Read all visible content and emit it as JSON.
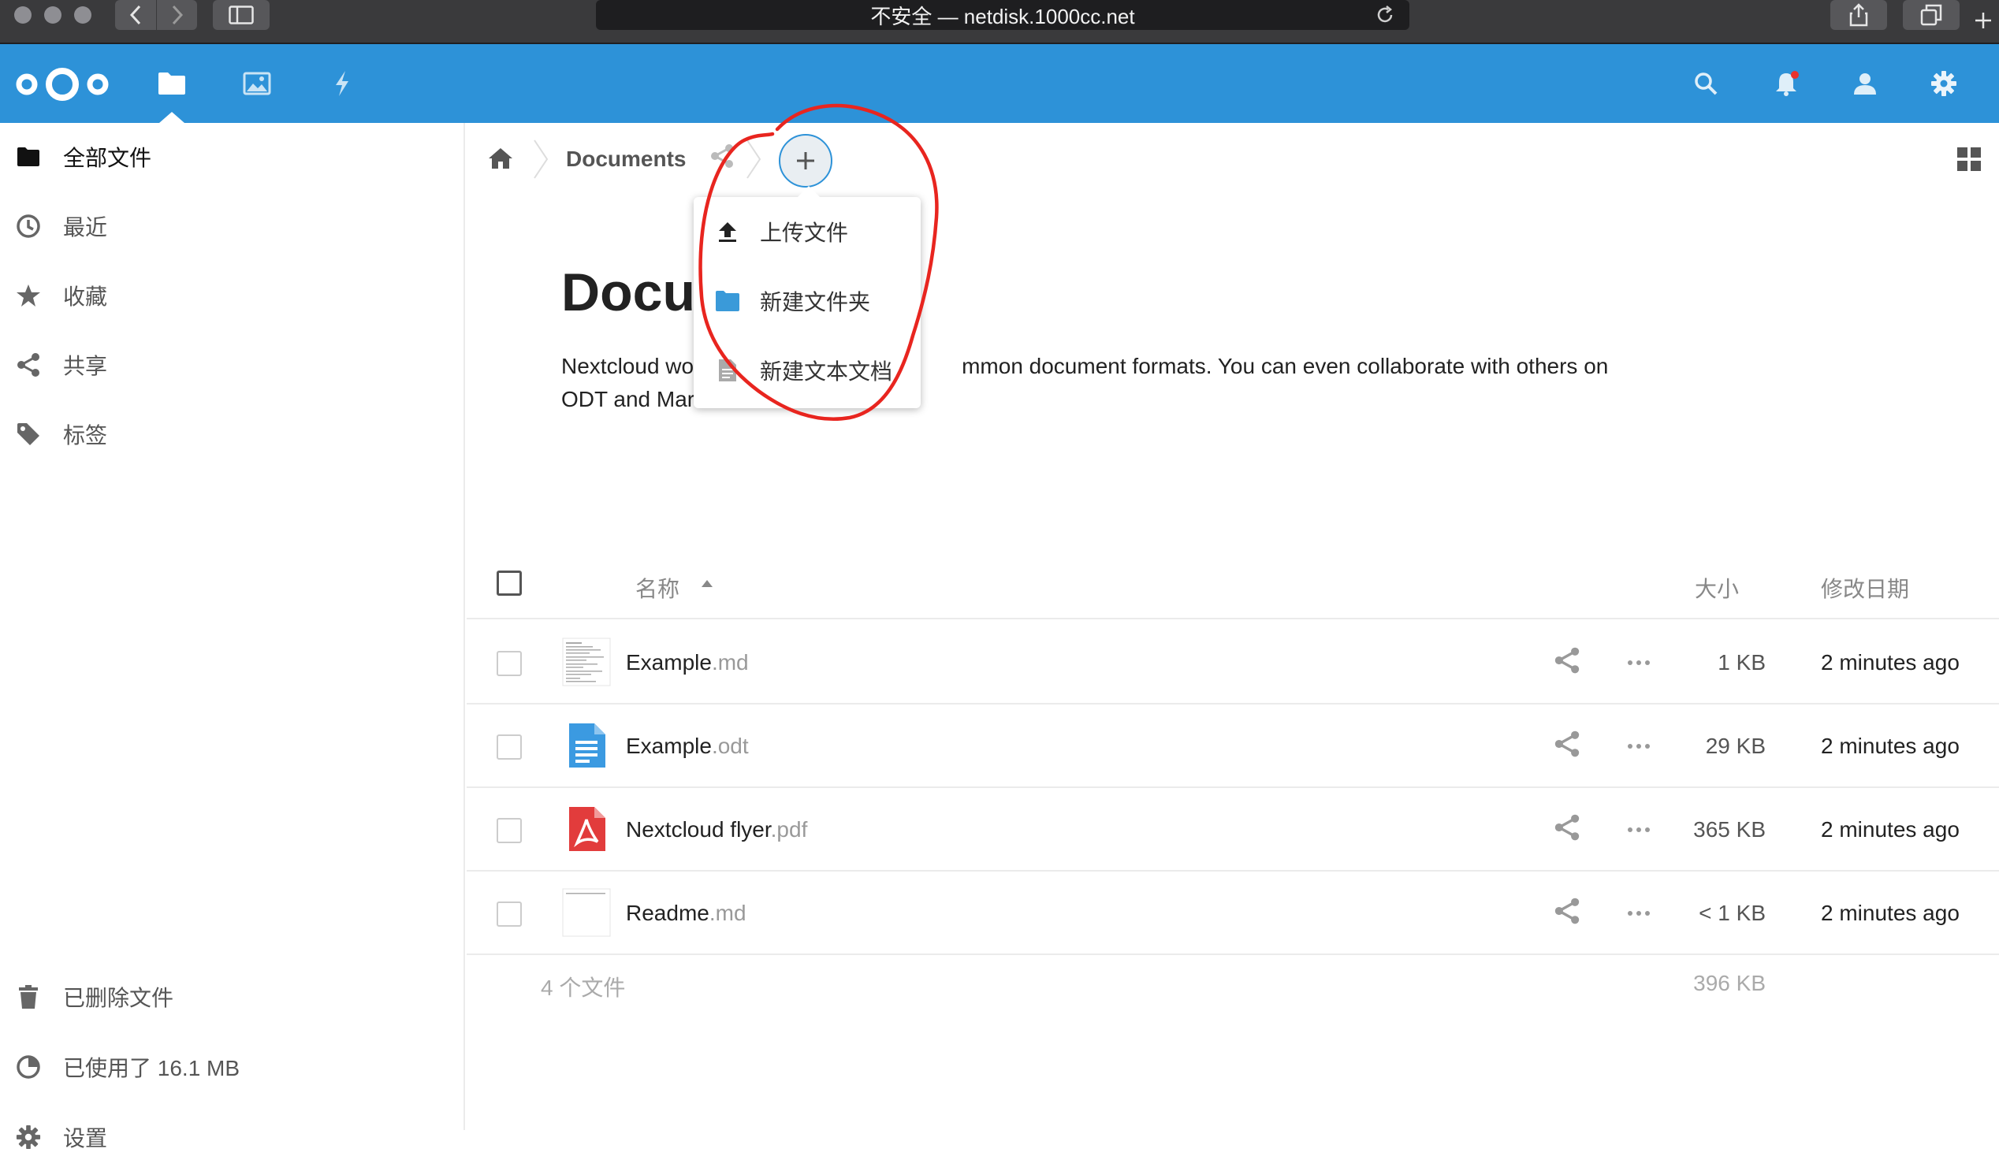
{
  "browser": {
    "url_text": "不安全 — netdisk.1000cc.net"
  },
  "header": {
    "apps": [
      "files-icon",
      "photos-icon",
      "activity-icon"
    ],
    "accent": "#2d92d8",
    "notification_color": "#e9322d"
  },
  "sidebar": {
    "items": [
      {
        "label": "全部文件",
        "icon": "folder-icon"
      },
      {
        "label": "最近",
        "icon": "clock-icon"
      },
      {
        "label": "收藏",
        "icon": "star-icon"
      },
      {
        "label": "共享",
        "icon": "share-icon"
      },
      {
        "label": "标签",
        "icon": "tag-icon"
      }
    ],
    "deleted_label": "已删除文件",
    "quota_label": "已使用了 16.1 MB",
    "settings_label": "设置"
  },
  "breadcrumb": {
    "current": "Documents"
  },
  "new_menu": {
    "items": [
      {
        "label": "上传文件",
        "icon": "upload-icon"
      },
      {
        "label": "新建文件夹",
        "icon": "folder-icon"
      },
      {
        "label": "新建文本文档",
        "icon": "text-document-icon"
      }
    ]
  },
  "readme": {
    "title": "Docu",
    "text_line1_start": "Nextcloud wo",
    "text_line1_end": "mmon document formats. You can even collaborate with others on",
    "text_line2": "ODT and Mar"
  },
  "table": {
    "headers": {
      "name": "名称",
      "size": "大小",
      "modified": "修改日期"
    },
    "rows": [
      {
        "base": "Example",
        "ext": ".md",
        "size": "1 KB",
        "modified": "2 minutes ago"
      },
      {
        "base": "Example",
        "ext": ".odt",
        "size": "29 KB",
        "modified": "2 minutes ago"
      },
      {
        "base": "Nextcloud flyer",
        "ext": ".pdf",
        "size": "365 KB",
        "modified": "2 minutes ago"
      },
      {
        "base": "Readme",
        "ext": ".md",
        "size": "< 1 KB",
        "modified": "2 minutes ago"
      }
    ],
    "summary": {
      "count": "4 个文件",
      "total_size": "396 KB"
    }
  }
}
